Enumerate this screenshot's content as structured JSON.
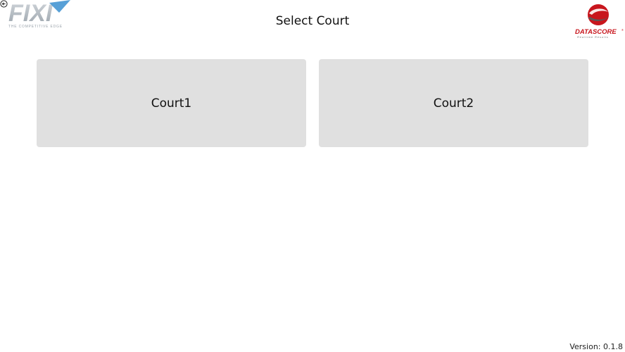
{
  "header": {
    "title": "Select Court",
    "back_icon": "back-arrow-icon",
    "left_logo": {
      "brand": "FIXI",
      "tagline": "THE COMPETITIVE EDGE",
      "brand_color": "#a8b0b8",
      "accent_color": "#3a8fd0"
    },
    "right_logo": {
      "brand": "DATASCORE",
      "trademark": "®",
      "tagline": "Realtime Results",
      "brand_color": "#c8161d"
    }
  },
  "courts": [
    {
      "label": "Court1"
    },
    {
      "label": "Court2"
    }
  ],
  "footer": {
    "version": "Version: 0.1.8"
  },
  "colors": {
    "court_button_bg": "#e0e0e0",
    "page_bg": "#ffffff"
  }
}
